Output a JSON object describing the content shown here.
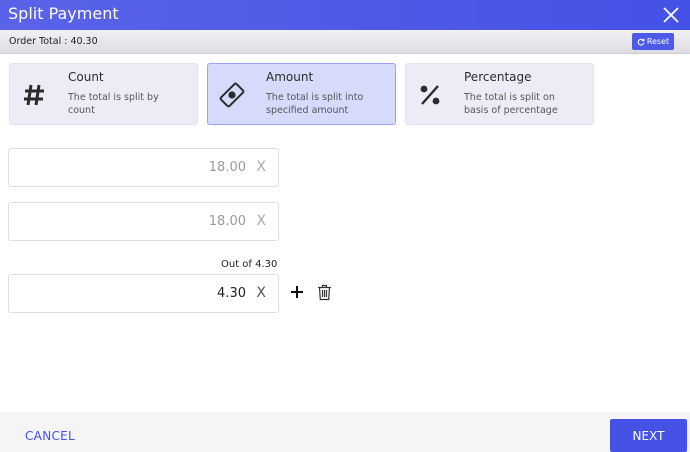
{
  "window": {
    "title": "Split Payment"
  },
  "header": {
    "order_total": "Order Total : 40.30",
    "reset_label": "Reset"
  },
  "split_modes": [
    {
      "title": "Count",
      "description": "The total is split by count",
      "icon": "hash-icon"
    },
    {
      "title": "Amount",
      "description": "The total is split into specified amount",
      "icon": "banknote-icon"
    },
    {
      "title": "Percentage",
      "description": "The total is split on basis of percentage",
      "icon": "percent-icon"
    }
  ],
  "selected_mode": "Amount",
  "amounts": [
    {
      "value": "18.00",
      "clear": "X"
    },
    {
      "value": "18.00",
      "clear": "X"
    },
    {
      "value": "4.30",
      "clear": "X"
    }
  ],
  "remaining_label": "Out of 4.30",
  "footer": {
    "cancel_label": "CANCEL",
    "next_label": "NEXT"
  },
  "colors": {
    "accent": "#4552e5",
    "selected_card": "#d7dbfb",
    "card": "#ececf6"
  }
}
